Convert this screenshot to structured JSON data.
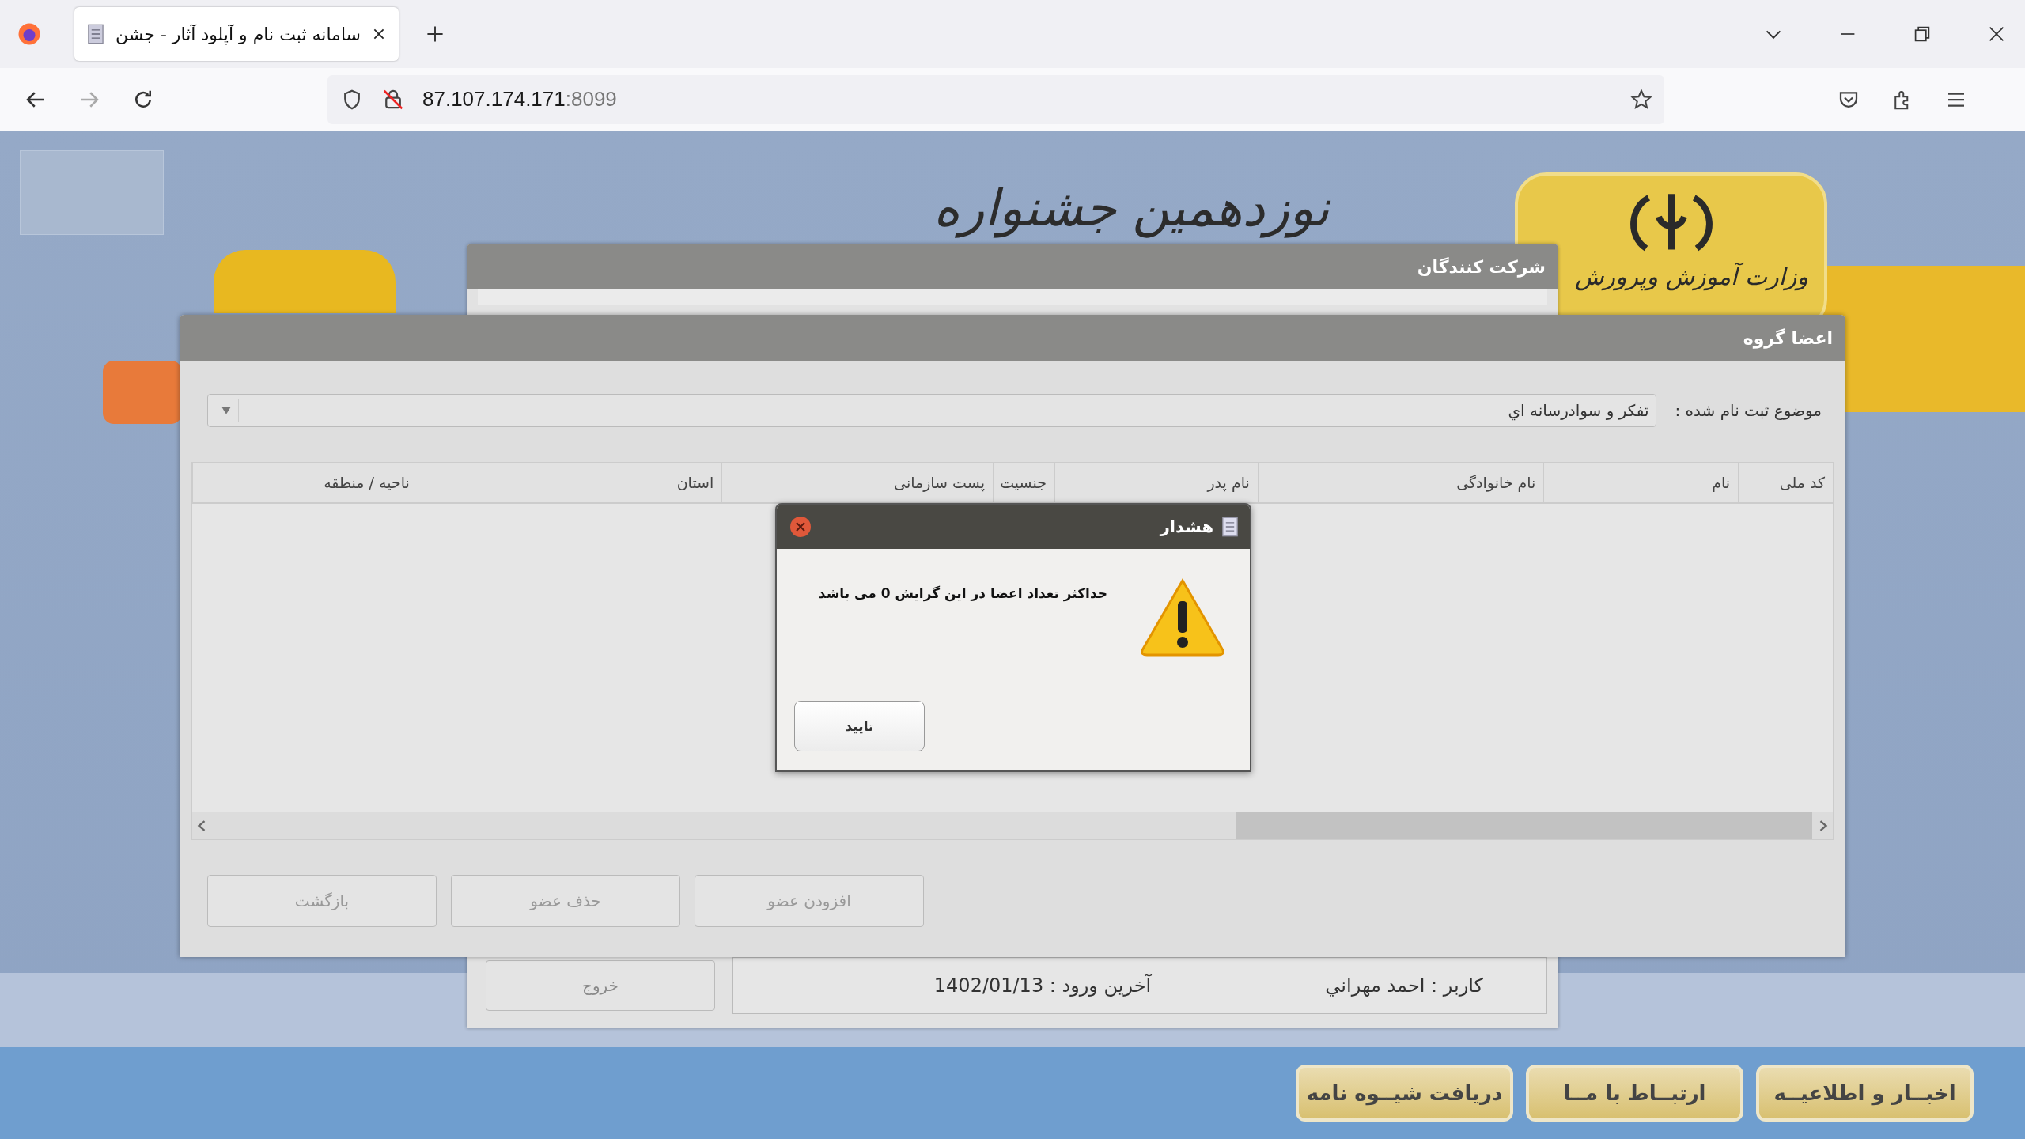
{
  "browser": {
    "tab_title": "سامانه ثبت نام و آپلود آثار - جشن",
    "url_host": "87.107.174.171",
    "url_port": ":8099"
  },
  "banner": {
    "title": "نوزدهمین جشنواره",
    "logo_text": "وزارت آموزش وپرورش"
  },
  "participants_window": {
    "title": "شرکت کنندگان",
    "exit_button": "خروج",
    "user": "کاربر : احمد مهراني",
    "last_login": "آخرین ورود : 1402/01/13"
  },
  "members_window": {
    "title": "اعضا گروه",
    "topic_label": "موضوع ثبت نام شده :",
    "topic_value": "تفکر و سوادرسانه اي",
    "columns": [
      "کد ملی",
      "نام",
      "نام خانوادگی",
      "نام پدر",
      "جنسیت",
      "پست سازمانی",
      "استان",
      "ناحیه / منطقه"
    ],
    "buttons": [
      {
        "label": "افزودن عضو",
        "disabled": true
      },
      {
        "label": "حذف عضو",
        "disabled": true
      },
      {
        "label": "بازگشت",
        "disabled": true
      }
    ]
  },
  "alert": {
    "title": "هشدار",
    "message": "حداکثر تعداد اعضا در این گرایش 0 می باشد",
    "ok_button": "تایید"
  },
  "footer_links": [
    "اخبــار و اطلاعیــه",
    "ارتبــاط با مــا",
    "دریافت شیــوه نامه"
  ]
}
